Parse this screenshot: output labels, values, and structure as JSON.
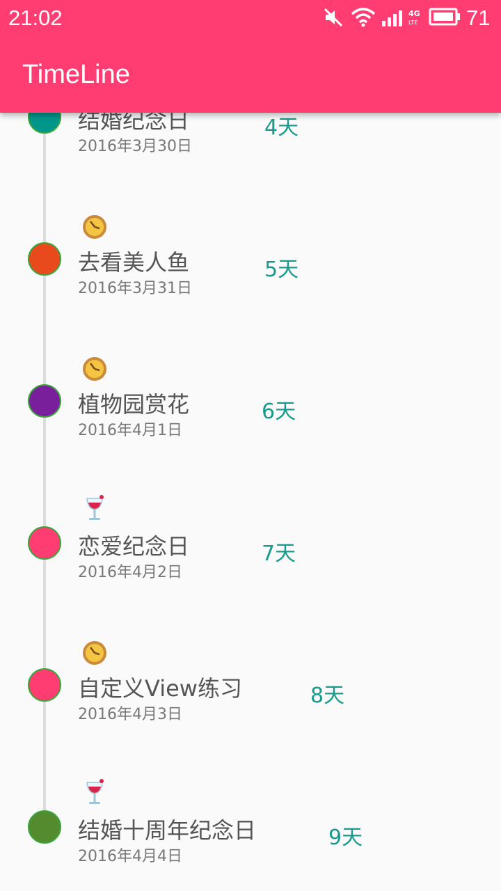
{
  "status_bar": {
    "time": "21:02",
    "battery_level": "71",
    "icons": [
      "mute-icon",
      "wifi-icon",
      "signal-icon",
      "4g-lte-icon",
      "battery-icon"
    ]
  },
  "toolbar": {
    "title": "TimeLine"
  },
  "colors": {
    "accent": "#ff3d73",
    "days_text": "#1a9a8c",
    "node_border": "#3aa63a"
  },
  "events": [
    {
      "title": "结婚纪念日",
      "date": "2016年3月30日",
      "days": "4天",
      "node_color": "#00968a",
      "icon": ""
    },
    {
      "title": "去看美人鱼",
      "date": "2016年3月31日",
      "days": "5天",
      "node_color": "#e84a1e",
      "icon": "clock-icon"
    },
    {
      "title": "植物园赏花",
      "date": "2016年4月1日",
      "days": "6天",
      "node_color": "#7a1f9c",
      "icon": "clock-icon"
    },
    {
      "title": "恋爱纪念日",
      "date": "2016年4月2日",
      "days": "7天",
      "node_color": "#ff3d73",
      "icon": "wine-glass-icon"
    },
    {
      "title": "自定义View练习",
      "date": "2016年4月3日",
      "days": "8天",
      "node_color": "#ff3d73",
      "icon": "clock-icon"
    },
    {
      "title": "结婚十周年纪念日",
      "date": "2016年4月4日",
      "days": "9天",
      "node_color": "#558b2f",
      "icon": "wine-glass-icon"
    }
  ]
}
